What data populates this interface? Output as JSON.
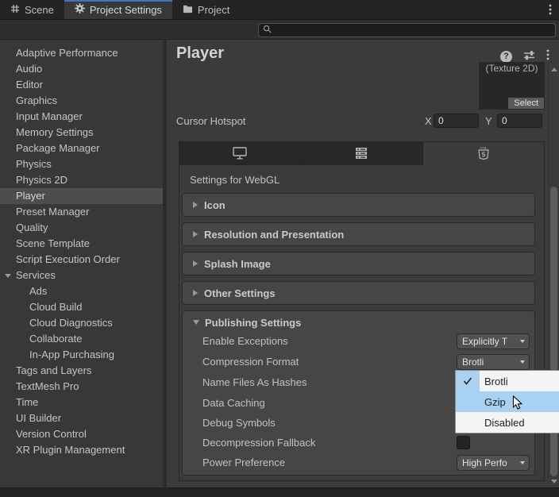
{
  "titlebar": {
    "tabs": [
      {
        "label": "Scene",
        "active": false
      },
      {
        "label": "Project Settings",
        "active": true
      },
      {
        "label": "Project",
        "active": false
      }
    ]
  },
  "search": {
    "value": ""
  },
  "sidebar": {
    "items": [
      {
        "label": "Adaptive Performance"
      },
      {
        "label": "Audio"
      },
      {
        "label": "Editor"
      },
      {
        "label": "Graphics"
      },
      {
        "label": "Input Manager"
      },
      {
        "label": "Memory Settings"
      },
      {
        "label": "Package Manager"
      },
      {
        "label": "Physics"
      },
      {
        "label": "Physics 2D"
      },
      {
        "label": "Player",
        "selected": true
      },
      {
        "label": "Preset Manager"
      },
      {
        "label": "Quality"
      },
      {
        "label": "Scene Template"
      },
      {
        "label": "Script Execution Order"
      },
      {
        "label": "Services",
        "expanded": true
      },
      {
        "label": "Ads",
        "child": true
      },
      {
        "label": "Cloud Build",
        "child": true
      },
      {
        "label": "Cloud Diagnostics",
        "child": true
      },
      {
        "label": "Collaborate",
        "child": true
      },
      {
        "label": "In-App Purchasing",
        "child": true
      },
      {
        "label": "Tags and Layers"
      },
      {
        "label": "TextMesh Pro"
      },
      {
        "label": "Time"
      },
      {
        "label": "UI Builder"
      },
      {
        "label": "Version Control"
      },
      {
        "label": "XR Plugin Management"
      }
    ]
  },
  "main": {
    "title": "Player",
    "help_glyph": "?",
    "texture_preview": {
      "label": "(Texture 2D)",
      "select_button": "Select"
    },
    "cursor_hotspot": {
      "label": "Cursor Hotspot",
      "x_label": "X",
      "x_value": "0",
      "y_label": "Y",
      "y_value": "0"
    },
    "platform_tabs": {
      "active_index": 2,
      "tabs": [
        {
          "name": "desktop"
        },
        {
          "name": "dedicated-server"
        },
        {
          "name": "webgl"
        }
      ]
    },
    "settings_for_label": "Settings for WebGL",
    "sections": [
      {
        "label": "Icon",
        "expanded": false
      },
      {
        "label": "Resolution and Presentation",
        "expanded": false
      },
      {
        "label": "Splash Image",
        "expanded": false
      },
      {
        "label": "Other Settings",
        "expanded": false
      },
      {
        "label": "Publishing Settings",
        "expanded": true
      }
    ],
    "publishing": {
      "rows": [
        {
          "label": "Enable Exceptions",
          "control": "dropdown",
          "value": "Explicitly T"
        },
        {
          "label": "Compression Format",
          "control": "dropdown",
          "value": "Brotli"
        },
        {
          "label": "Name Files As Hashes",
          "control": "checkbox",
          "checked": false
        },
        {
          "label": "Data Caching",
          "control": "checkbox",
          "checked": false
        },
        {
          "label": "Debug Symbols",
          "control": "checkbox",
          "checked": false
        },
        {
          "label": "Decompression Fallback",
          "control": "checkbox",
          "checked": false
        },
        {
          "label": "Power Preference",
          "control": "dropdown",
          "value": "High Perfo"
        }
      ]
    },
    "compression_menu": {
      "items": [
        {
          "label": "Brotli",
          "checked": true,
          "hovered": false
        },
        {
          "label": "Gzip",
          "checked": false,
          "hovered": true
        },
        {
          "label": "Disabled",
          "checked": false,
          "hovered": false
        }
      ]
    }
  },
  "colors": {
    "tab_accent": "#3e74b8",
    "menu_highlight": "#a8d1f2",
    "sidebar_selection": "#4d4d4d",
    "panel_bg": "#3b3b3b"
  }
}
